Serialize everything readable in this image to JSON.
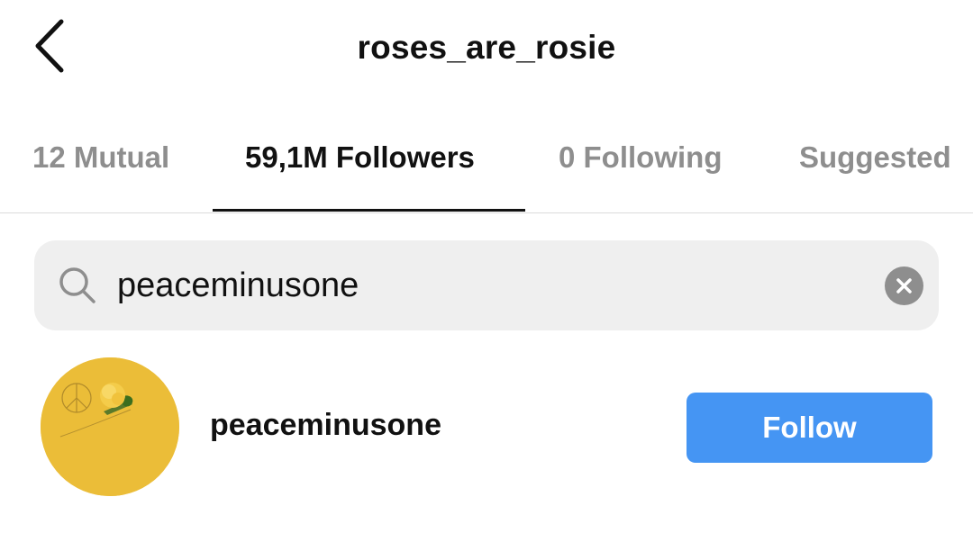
{
  "header": {
    "title": "roses_are_rosie",
    "back_icon": "chevron-left-icon"
  },
  "tabs": [
    {
      "label": "12 Mutual",
      "active": false
    },
    {
      "label": "59,1M Followers",
      "active": true
    },
    {
      "label": "0 Following",
      "active": false
    },
    {
      "label": "Suggested",
      "active": false
    }
  ],
  "search": {
    "icon": "search-icon",
    "value": "peaceminusone",
    "clear_icon": "clear-icon"
  },
  "results": [
    {
      "username": "peaceminusone",
      "avatar": "yellow-rose-avatar",
      "follow_label": "Follow"
    }
  ],
  "colors": {
    "accent": "#4595f3",
    "inactive_tab": "#8e8e8e",
    "search_bg": "#efefef",
    "avatar_bg": "#ebbd38"
  }
}
